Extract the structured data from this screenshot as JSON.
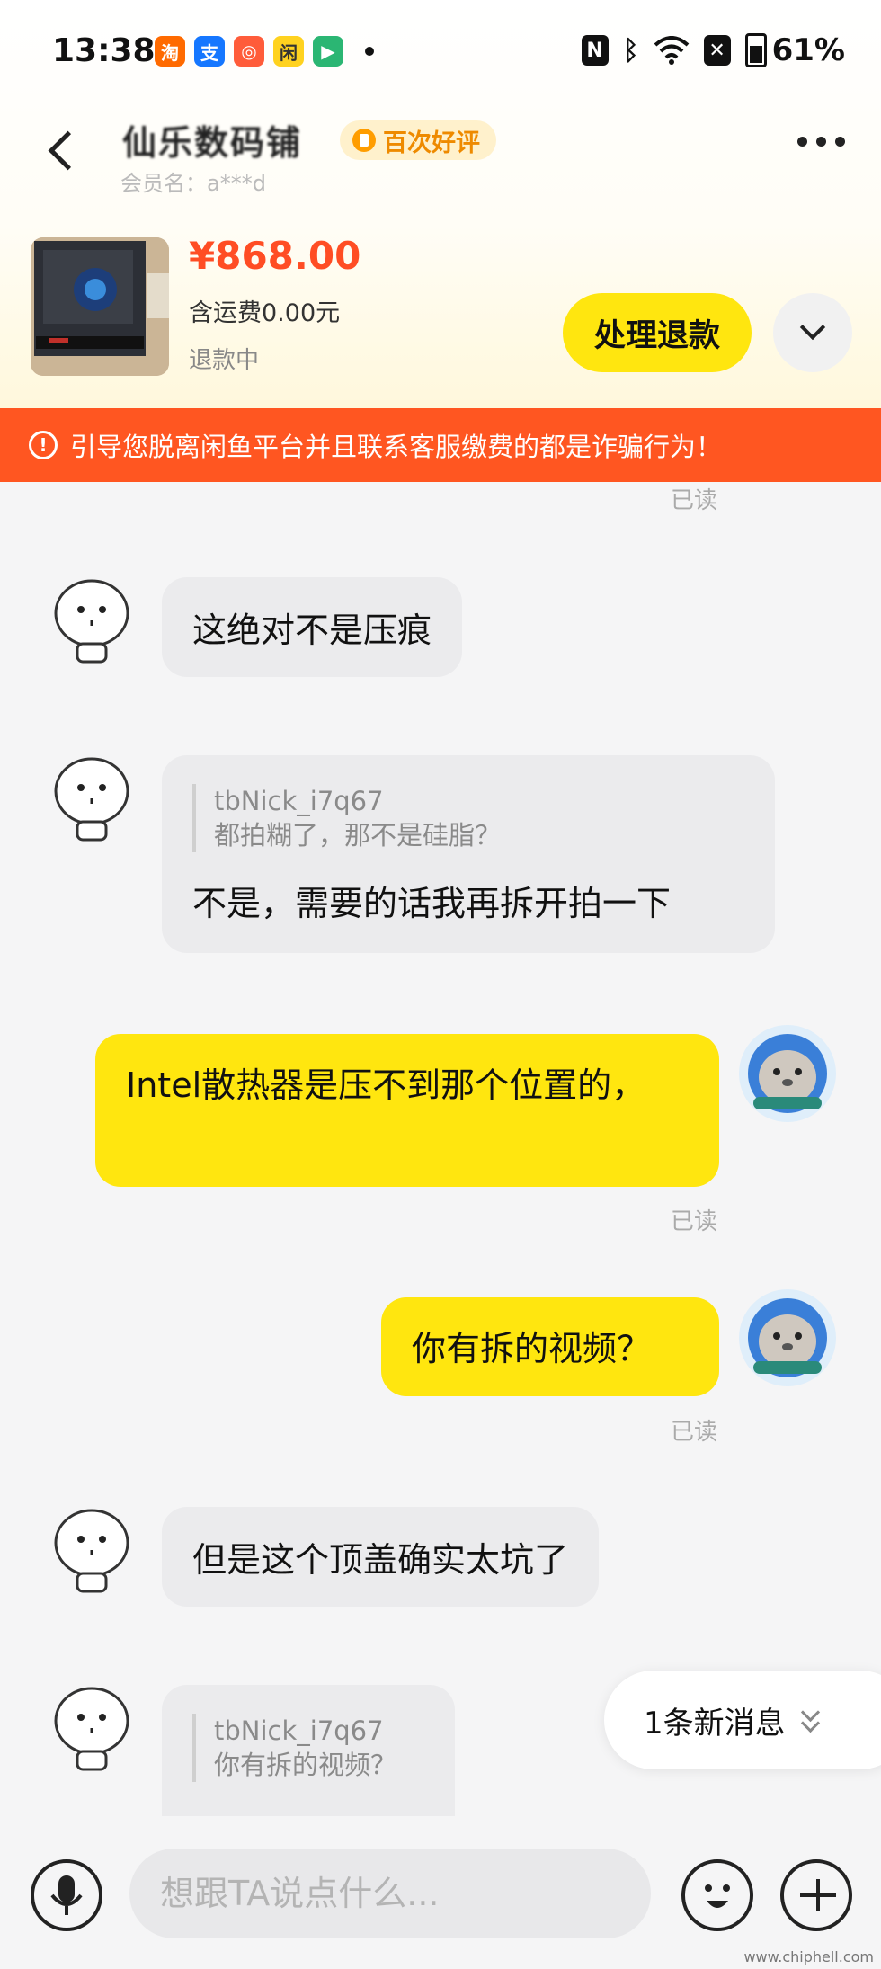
{
  "status_bar": {
    "time": "13:38",
    "battery": "61%",
    "notification_icons": [
      "taobao-icon",
      "alipay-icon",
      "app-icon",
      "game-icon",
      "video-icon"
    ]
  },
  "header": {
    "shop_name": "仙乐数码铺",
    "badge": "百次好评",
    "member": "会员名：a***d"
  },
  "order": {
    "price": "¥868.00",
    "shipping": "含运费0.00元",
    "status": "退款中",
    "refund_button": "处理退款"
  },
  "warning": "引导您脱离闲鱼平台并且联系客服缴费的都是诈骗行为！",
  "messages": {
    "read_top": "已读",
    "m1": "这绝对不是压痕",
    "m2_quote_name": "tbNick_i7q67",
    "m2_quote_text": "都拍糊了，那不是硅脂？",
    "m2": "不是，需要的话我再拆开拍一下",
    "m3": "Intel散热器是压不到那个位置的，",
    "m3_read": "已读",
    "m4": "你有拆的视频？",
    "m4_read": "已读",
    "m5": "但是这个顶盖确实太坑了",
    "m6_quote_name": "tbNick_i7q67",
    "m6_quote_text": "你有拆的视频？"
  },
  "new_message": "1条新消息",
  "input": {
    "placeholder": "想跟TA说点什么..."
  },
  "watermark": "www.chiphell.com",
  "colors": {
    "accent_yellow": "#ffe60f",
    "warning_orange": "#ff5621",
    "price_red": "#ff4d24"
  }
}
